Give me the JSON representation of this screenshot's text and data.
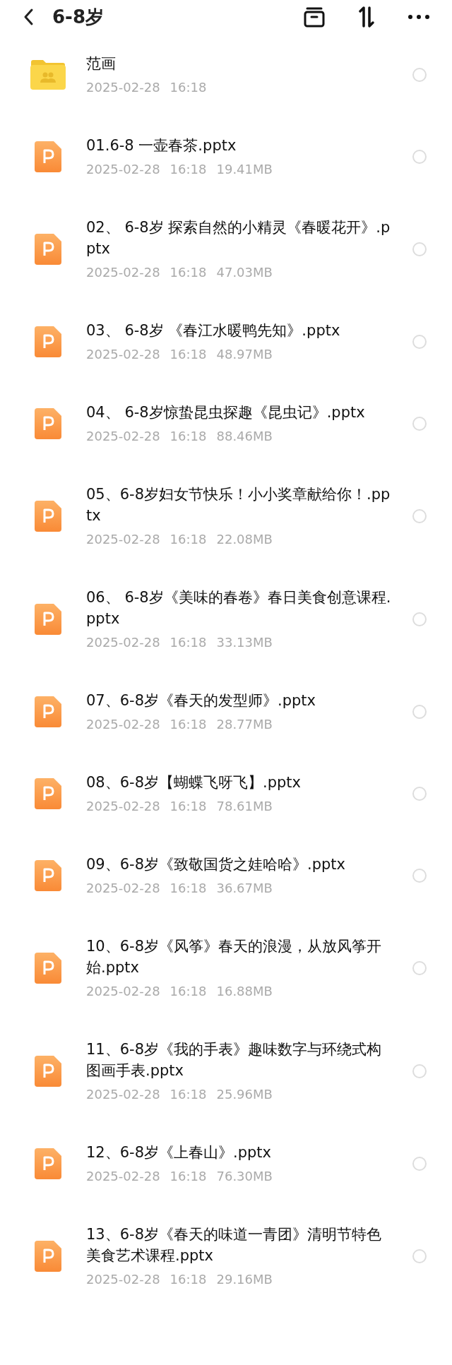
{
  "header": {
    "title": "6-8岁"
  },
  "items": [
    {
      "kind": "folder",
      "name": "范画",
      "date": "2025-02-28",
      "time": "16:18",
      "selected": false
    },
    {
      "kind": "pptx",
      "name": "01.6-8 一壶春茶.pptx",
      "date": "2025-02-28",
      "time": "16:18",
      "size": "19.41MB",
      "selected": false
    },
    {
      "kind": "pptx",
      "name": "02、 6-8岁 探索自然的小精灵《春暖花开》.pptx",
      "date": "2025-02-28",
      "time": "16:18",
      "size": "47.03MB",
      "selected": false
    },
    {
      "kind": "pptx",
      "name": "03、 6-8岁 《春江水暖鸭先知》.pptx",
      "date": "2025-02-28",
      "time": "16:18",
      "size": "48.97MB",
      "selected": false
    },
    {
      "kind": "pptx",
      "name": "04、 6-8岁惊蛰昆虫探趣《昆虫记》.pptx",
      "date": "2025-02-28",
      "time": "16:18",
      "size": "88.46MB",
      "selected": false
    },
    {
      "kind": "pptx",
      "name": "05、6-8岁妇女节快乐！小小奖章献给你！.pptx",
      "date": "2025-02-28",
      "time": "16:18",
      "size": "22.08MB",
      "selected": false
    },
    {
      "kind": "pptx",
      "name": "06、 6-8岁《美味的春卷》春日美食创意课程.pptx",
      "date": "2025-02-28",
      "time": "16:18",
      "size": "33.13MB",
      "selected": false
    },
    {
      "kind": "pptx",
      "name": "07、6-8岁《春天的发型师》.pptx",
      "date": "2025-02-28",
      "time": "16:18",
      "size": "28.77MB",
      "selected": false
    },
    {
      "kind": "pptx",
      "name": "08、6-8岁【蝴蝶飞呀飞】.pptx",
      "date": "2025-02-28",
      "time": "16:18",
      "size": "78.61MB",
      "selected": false
    },
    {
      "kind": "pptx",
      "name": "09、6-8岁《致敬国货之娃哈哈》.pptx",
      "date": "2025-02-28",
      "time": "16:18",
      "size": "36.67MB",
      "selected": false
    },
    {
      "kind": "pptx",
      "name": "10、6-8岁《风筝》春天的浪漫，从放风筝开始.pptx",
      "date": "2025-02-28",
      "time": "16:18",
      "size": "16.88MB",
      "selected": false
    },
    {
      "kind": "pptx",
      "name": "11、6-8岁《我的手表》趣味数字与环绕式构图画手表.pptx",
      "date": "2025-02-28",
      "time": "16:18",
      "size": "25.96MB",
      "selected": false
    },
    {
      "kind": "pptx",
      "name": "12、6-8岁《上春山》.pptx",
      "date": "2025-02-28",
      "time": "16:18",
      "size": "76.30MB",
      "selected": false
    },
    {
      "kind": "pptx",
      "name": "13、6-8岁《春天的味道一青团》清明节特色美食艺术课程.pptx",
      "date": "2025-02-28",
      "time": "16:18",
      "size": "29.16MB",
      "selected": false
    }
  ]
}
